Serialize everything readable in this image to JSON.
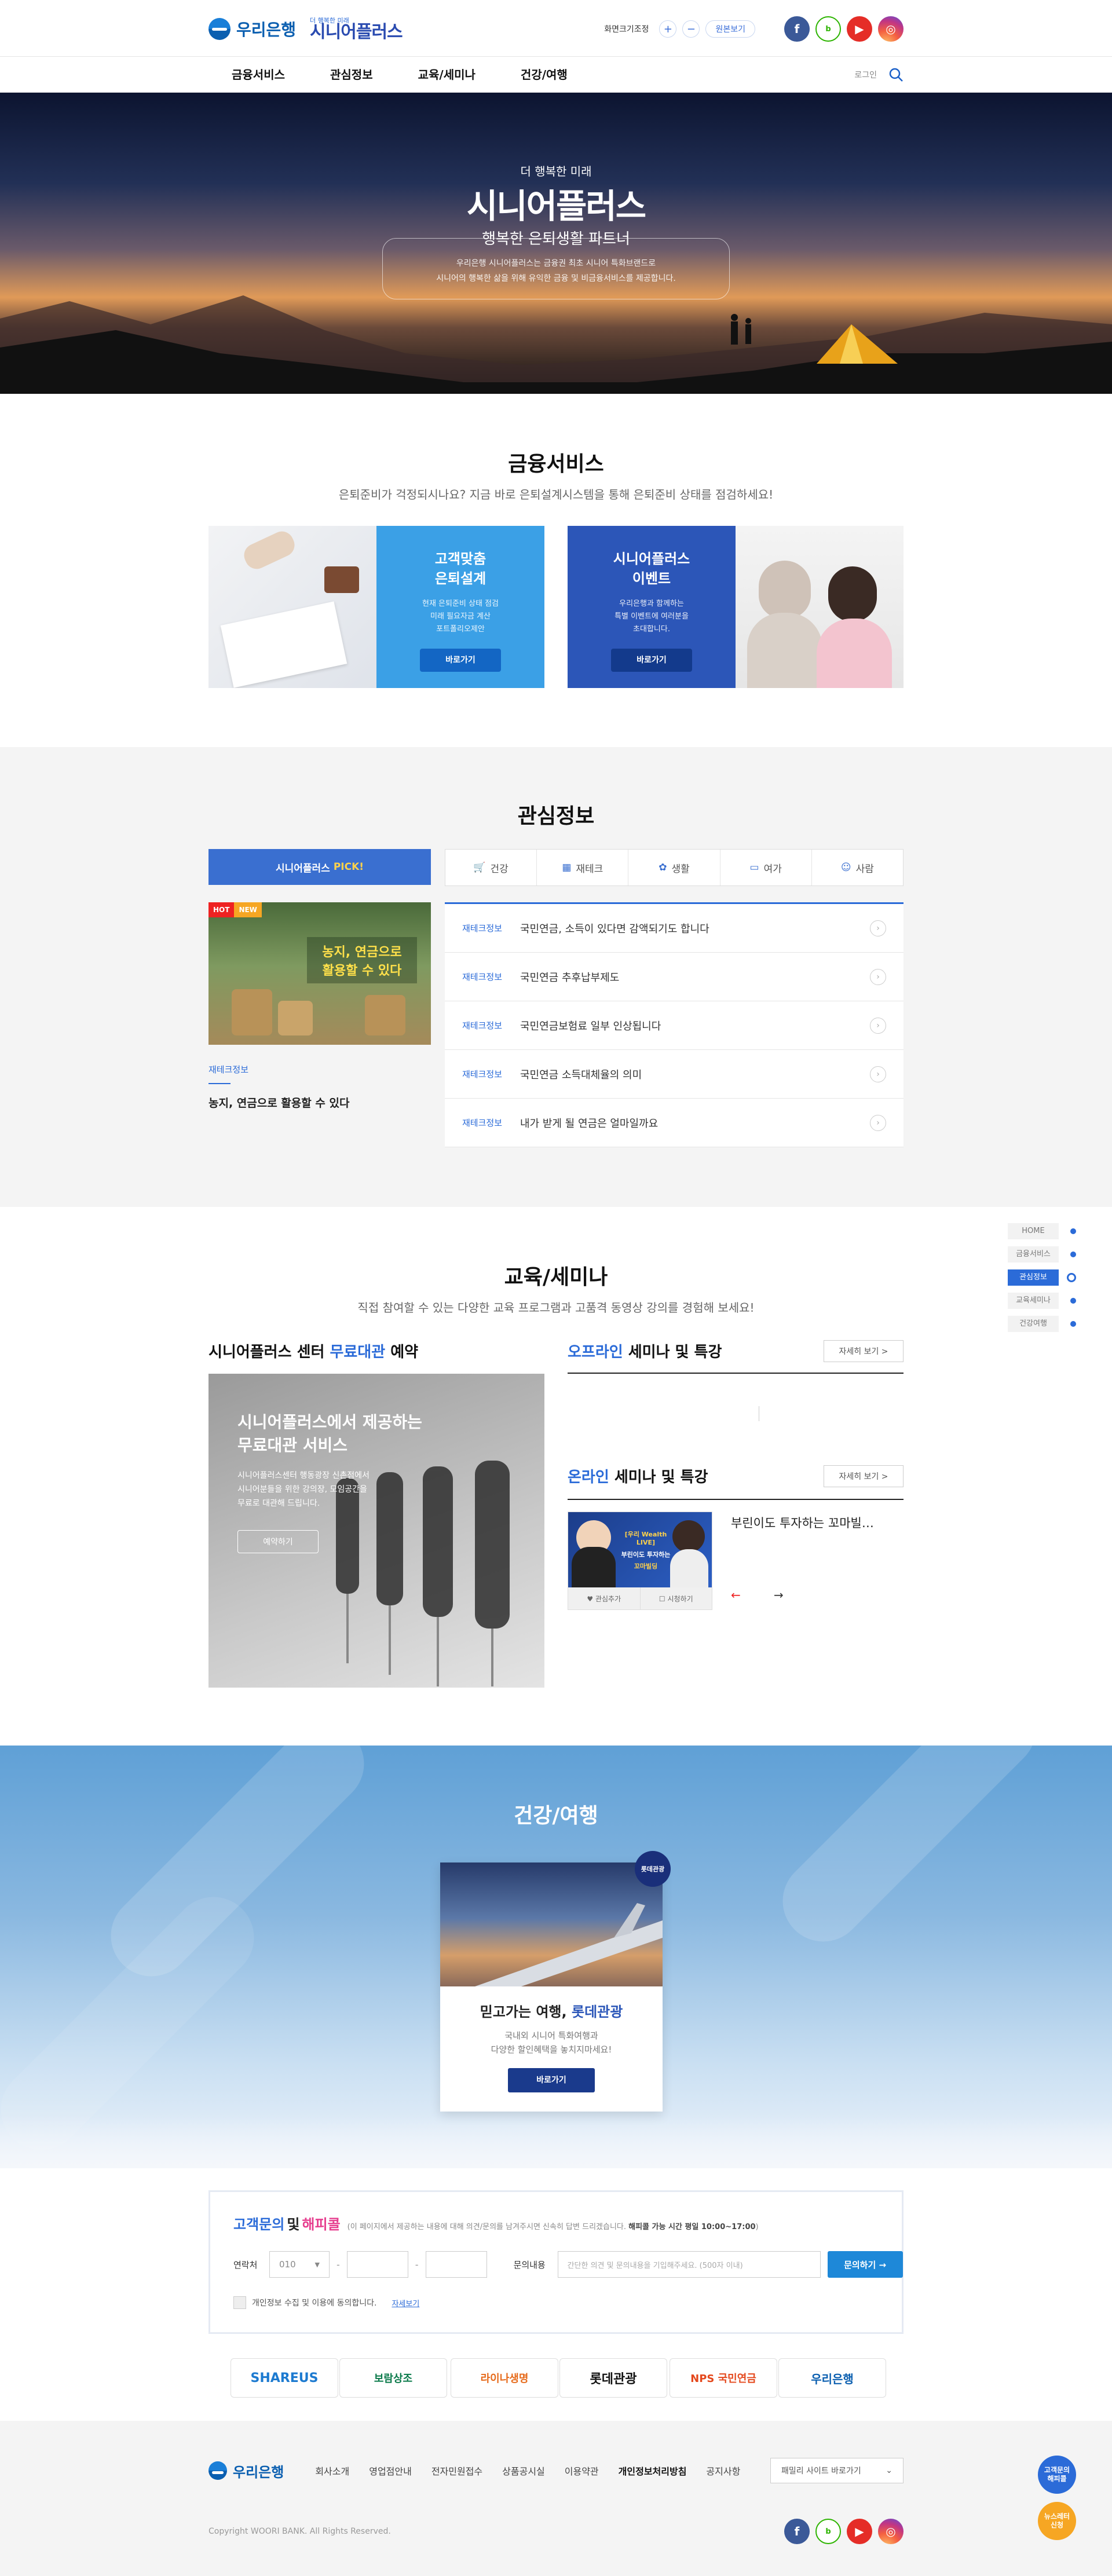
{
  "header": {
    "brand": "우리은행",
    "sub_tiny": "더 행복한 미래",
    "sub_big": "시니어플러스",
    "font_size_label": "화면크기조정",
    "zoom_in": "+",
    "zoom_out": "−",
    "reset": "원본보기",
    "sns": {
      "facebook": "f",
      "blog": "b",
      "youtube": "▶",
      "instagram": "◎"
    }
  },
  "gnb": {
    "items": [
      "금융서비스",
      "관심정보",
      "교육/세미나",
      "건강/여행"
    ],
    "login": "로그인"
  },
  "hero": {
    "eyebrow": "더 행복한 미래",
    "brand": "시니어플러스",
    "tagline": "행복한 은퇴생활 파트너",
    "desc1": "우리은행 시니어플러스는 금융권 최초 시니어 특화브랜드로",
    "desc2": "시니어의 행복한 삶을 위해 유익한 금융 및 비금융서비스를 제공합니다."
  },
  "finance": {
    "title": "금융서비스",
    "subtitle": "은퇴준비가 걱정되시나요? 지금 바로 은퇴설계시스템을 통해 은퇴준비 상태를 점검하세요!",
    "card1": {
      "title1": "고객맞춤",
      "title2": "은퇴설계",
      "d1": "현재 은퇴준비 상태 점검",
      "d2": "미래 필요자금 계산",
      "d3": "포트폴리오제안",
      "btn": "바로가기"
    },
    "card2": {
      "title1": "시니어플러스",
      "title2": "이벤트",
      "d1": "우리은행과 함께하는",
      "d2": "특별 이벤트에 여러분을",
      "d3": "초대합니다.",
      "btn": "바로가기"
    }
  },
  "interest": {
    "title": "관심정보",
    "pick_label": "시니어플러스",
    "pick_hl": "PICK!",
    "badge_hot": "HOT",
    "badge_new": "NEW",
    "thumb_text1": "농지, 연금으로",
    "thumb_text2": "활용할 수 있다",
    "pick_cat": "재테크정보",
    "pick_title": "농지, 연금으로 활용할 수 있다",
    "tabs": [
      {
        "icon": "🛒",
        "label": "건강"
      },
      {
        "icon": "▦",
        "label": "재테크"
      },
      {
        "icon": "✿",
        "label": "생활"
      },
      {
        "icon": "▭",
        "label": "여가"
      },
      {
        "icon": "☺",
        "label": "사람"
      }
    ],
    "rows": [
      {
        "cat": "재테크정보",
        "title": "국민연금, 소득이 있다면 감액되기도 합니다"
      },
      {
        "cat": "재테크정보",
        "title": "국민연금 추후납부제도"
      },
      {
        "cat": "재테크정보",
        "title": "국민연금보험료 일부 인상됩니다"
      },
      {
        "cat": "재테크정보",
        "title": "국민연금 소득대체율의 의미"
      },
      {
        "cat": "재테크정보",
        "title": "내가 받게 될 연금은 얼마일까요"
      }
    ]
  },
  "quicknav": [
    "HOME",
    "금융서비스",
    "관심정보",
    "교육세미나",
    "건강여행"
  ],
  "edu": {
    "title": "교육/세미나",
    "subtitle": "직접 참여할 수 있는 다양한 교육 프로그램과 고품격 동영상 강의를 경험해 보세요!",
    "center_title_pre": "시니어플러스 센터 ",
    "center_title_hl": "무료대관",
    "center_title_post": " 예약",
    "center_card_t1": "시니어플러스에서 제공하는",
    "center_card_t2": "무료대관 서비스",
    "center_card_d1": "시니어플러스센터 행동광장 신촌점에서",
    "center_card_d2": "시니어분들을 위한 강의장, 모임공간을",
    "center_card_d3": "무료로 대관해 드립니다.",
    "center_card_btn": "예약하기",
    "offline_hl": "오프라인",
    "offline_post": " 세미나 및 특강",
    "online_hl": "온라인",
    "online_post": " 세미나 및 특강",
    "more": "자세히 보기 >",
    "video_title": "부린이도 투자하는 꼬마빌…",
    "video_thumb1": "[우리 Wealth LIVE]",
    "video_thumb2": "부린이도 투자하는",
    "video_thumb3": "꼬마빌딩",
    "fav": "♥ 관심추가",
    "watch": "☐ 시청하기",
    "prev": "←",
    "next": "→"
  },
  "health": {
    "title": "건강/여행",
    "badge": "롯데관광",
    "card_title_pre": "믿고가는 여행, ",
    "card_title_hl": "롯데관광",
    "d1": "국내외 시니어 특화여행과",
    "d2": "다양한 할인혜택을 놓치지마세요!",
    "btn": "바로가기"
  },
  "inquiry": {
    "title_hl1": "고객문의",
    "title_mid": " 및 ",
    "title_hl2": "해피콜",
    "note_pre": "(이 페이지에서 제공하는 내용에 대해 의견/문의를 남겨주시면 신속히 답변 드리겠습니다. ",
    "note_strong": "해피콜 가능 시간 평일 10:00~17:00",
    "note_post": ")",
    "phone_label": "연락처",
    "phone_prefix": "010",
    "msg_label": "문의내용",
    "msg_placeholder": "간단한 의견 및 문의내용을 기입해주세요. (500자 이내)",
    "submit": "문의하기 →",
    "agree": "개인정보 수집 및 이용에 동의합니다.",
    "agree_link": "자세보기"
  },
  "partners": [
    "SHAREUS",
    "보람상조",
    "라이나생명",
    "롯데관광",
    "NPS 국민연금",
    "우리은행"
  ],
  "footer": {
    "brand": "우리은행",
    "menu": [
      "회사소개",
      "영업점안내",
      "전자민원접수",
      "상품공시실",
      "이용약관",
      "개인정보처리방침",
      "공지사항"
    ],
    "family_site": "패밀리 사이트 바로가기",
    "copyright": "Copyright WOORI BANK. All Rights Reserved.",
    "float1_1": "고객문의",
    "float1_2": "해피콜",
    "float2_1": "뉴스레터",
    "float2_2": "신청"
  }
}
